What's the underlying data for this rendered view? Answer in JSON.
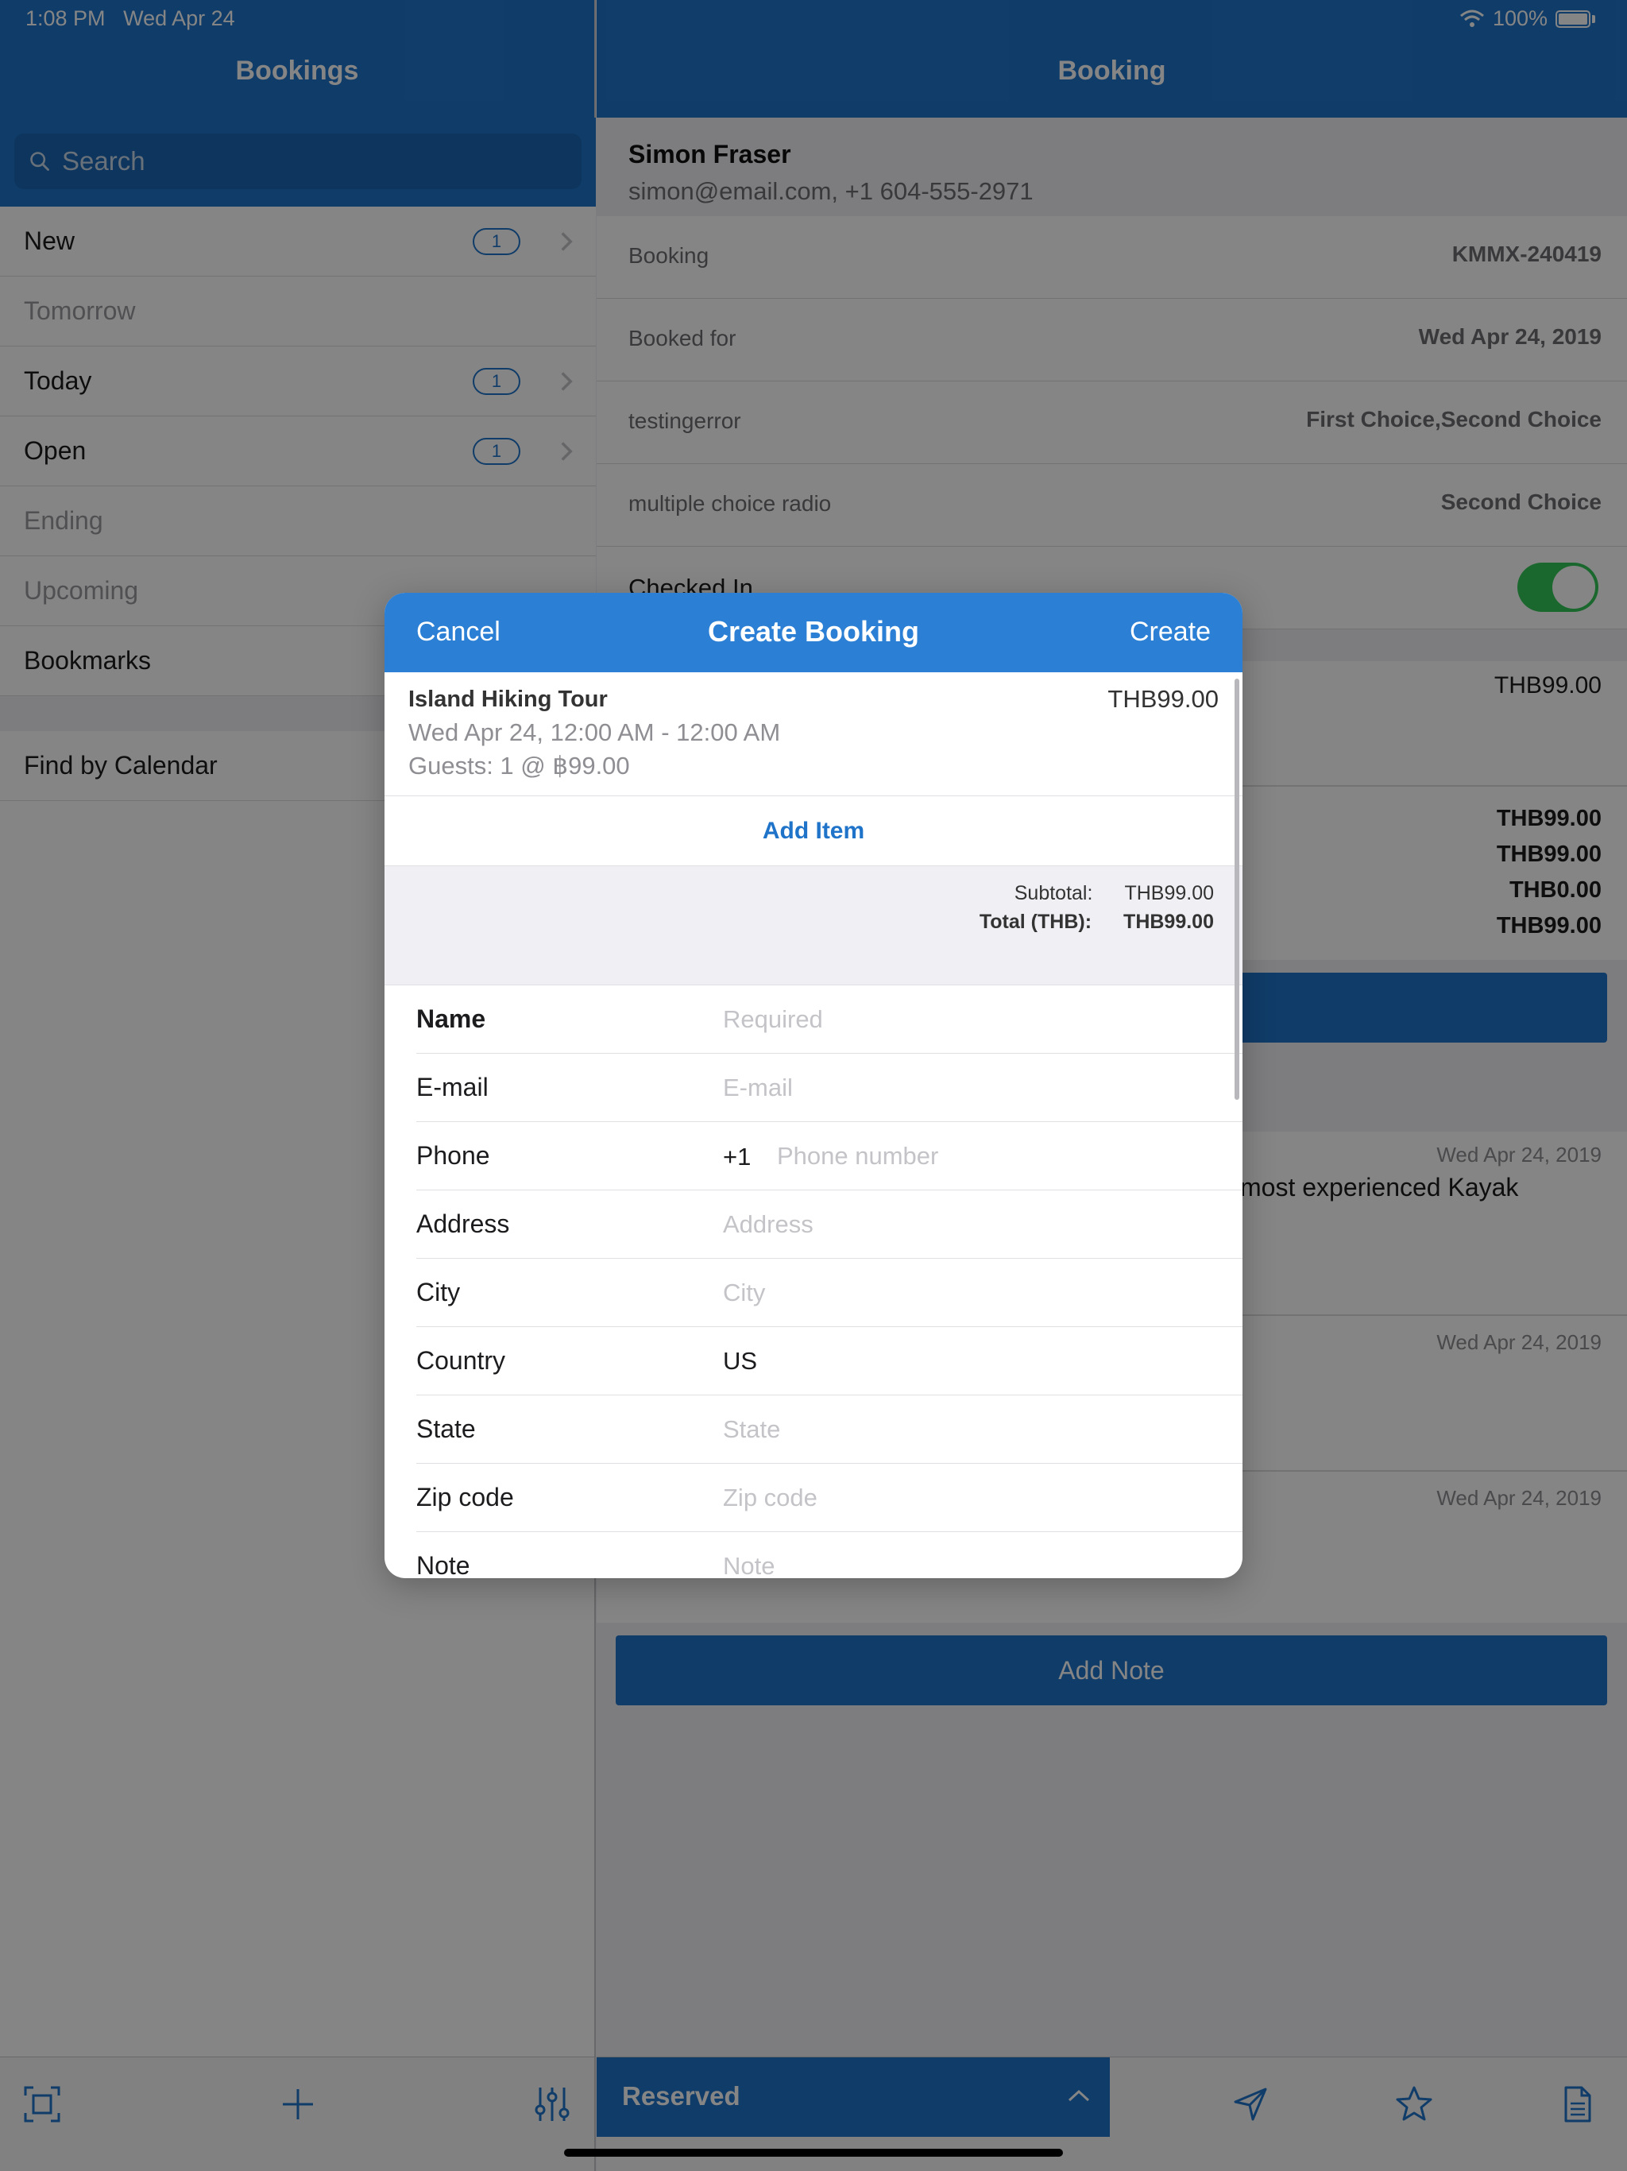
{
  "status": {
    "time": "1:08 PM",
    "date": "Wed Apr 24",
    "battery": "100%"
  },
  "master": {
    "title": "Bookings",
    "search_placeholder": "Search",
    "items": [
      {
        "label": "New",
        "badge": "1",
        "enabled": true
      },
      {
        "label": "Tomorrow",
        "badge": "",
        "enabled": false
      },
      {
        "label": "Today",
        "badge": "1",
        "enabled": true
      },
      {
        "label": "Open",
        "badge": "1",
        "enabled": true
      },
      {
        "label": "Ending",
        "badge": "",
        "enabled": false
      },
      {
        "label": "Upcoming",
        "badge": "",
        "enabled": false
      },
      {
        "label": "Bookmarks",
        "badge": "",
        "enabled": true
      }
    ],
    "find_by_calendar": "Find by Calendar",
    "toolbar_icons": [
      "scan-icon",
      "plus-icon",
      "sliders-icon"
    ]
  },
  "detail": {
    "title": "Booking",
    "customer_name": "Simon Fraser",
    "customer_contact": "simon@email.com, +1 604-555-2971",
    "rows": [
      {
        "label": "Booking",
        "value": "KMMX-240419"
      },
      {
        "label": "Booked for",
        "value": "Wed Apr 24, 2019"
      },
      {
        "label": "testingerror",
        "value": "First Choice,Second Choice"
      },
      {
        "label": "multiple choice radio",
        "value": "Second Choice"
      },
      {
        "label": "Checked In",
        "value": ""
      }
    ],
    "checked_in": true,
    "item_price": "THB99.00",
    "amounts": [
      "THB99.00",
      "THB99.00",
      "THB0.00",
      "THB99.00"
    ],
    "note_snippet": "most experienced Kayak",
    "note_dates": [
      "Wed Apr 24, 2019",
      "Wed Apr 24, 2019",
      "Wed Apr 24, 2019"
    ],
    "add_note_label": "Add Note",
    "reserved_label": "Reserved",
    "toolbar_icons": [
      "send-icon",
      "star-icon",
      "document-icon"
    ]
  },
  "modal": {
    "cancel": "Cancel",
    "title": "Create Booking",
    "create": "Create",
    "item": {
      "name": "Island Hiking Tour",
      "price": "THB99.00",
      "date": "Wed Apr 24, 12:00 AM  - 12:00 AM",
      "guests": "Guests: 1 @ ฿99.00"
    },
    "add_item": "Add Item",
    "subtotal_label": "Subtotal:",
    "subtotal_value": "THB99.00",
    "total_label": "Total (THB):",
    "total_value": "THB99.00",
    "form": {
      "name": {
        "label": "Name",
        "placeholder": "Required",
        "value": ""
      },
      "email": {
        "label": "E-mail",
        "placeholder": "E-mail",
        "value": ""
      },
      "phone": {
        "label": "Phone",
        "prefix": "+1",
        "placeholder": "Phone number",
        "value": ""
      },
      "address": {
        "label": "Address",
        "placeholder": "Address",
        "value": ""
      },
      "city": {
        "label": "City",
        "placeholder": "City",
        "value": ""
      },
      "country": {
        "label": "Country",
        "placeholder": "",
        "value": "US"
      },
      "state": {
        "label": "State",
        "placeholder": "State",
        "value": ""
      },
      "zip": {
        "label": "Zip code",
        "placeholder": "Zip code",
        "value": ""
      },
      "note": {
        "label": "Note",
        "placeholder": "Note",
        "value": ""
      }
    }
  },
  "colors": {
    "brand": "#1f74c9",
    "toggle_on": "#34c759"
  }
}
